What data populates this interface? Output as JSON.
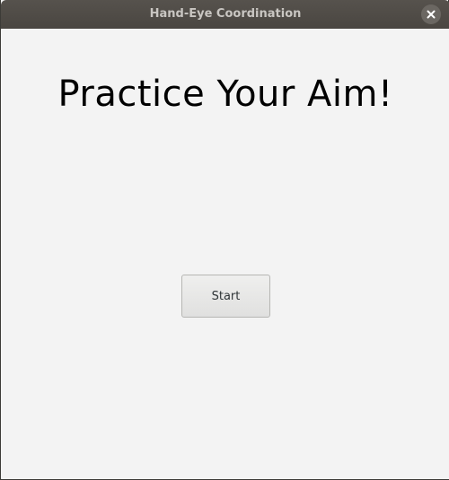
{
  "window": {
    "title": "Hand-Eye Coordination",
    "close_icon": "close-icon"
  },
  "main": {
    "heading": "Practice Your Aim!",
    "start_label": "Start"
  },
  "colors": {
    "titlebar": "#4d4944",
    "background": "#f3f3f3",
    "button": "#e8e8e7"
  }
}
